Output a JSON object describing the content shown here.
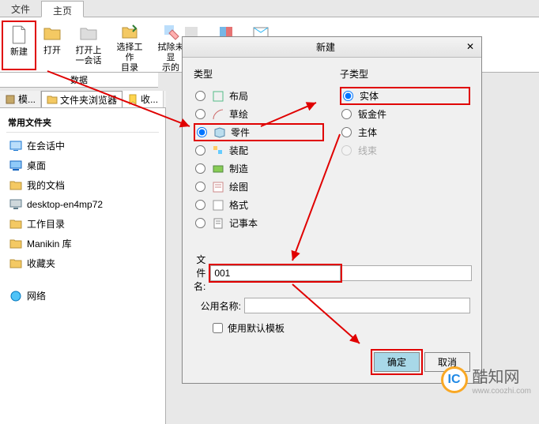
{
  "menu": {
    "file": "文件",
    "home": "主页"
  },
  "ribbon": {
    "new": "新建",
    "open": "打开",
    "open_prev": "打开上一会话",
    "select_workdir": "选择工作\n目录",
    "erase_hidden": "拭除未显\n示的",
    "group_data": "数据"
  },
  "sidebar_tabs": {
    "model": "模...",
    "browser": "文件夹浏览器",
    "collect": "收..."
  },
  "sidebar": {
    "header": "常用文件夹",
    "items": [
      {
        "label": "在会话中",
        "icon": "screen"
      },
      {
        "label": "桌面",
        "icon": "desktop"
      },
      {
        "label": "我的文档",
        "icon": "folder"
      },
      {
        "label": "desktop-en4mp72",
        "icon": "computer"
      },
      {
        "label": "工作目录",
        "icon": "folder"
      },
      {
        "label": "Manikin 库",
        "icon": "folder"
      },
      {
        "label": "收藏夹",
        "icon": "folder"
      }
    ],
    "network": "网络"
  },
  "dialog": {
    "title": "新建",
    "group_type": "类型",
    "group_subtype": "子类型",
    "types": [
      {
        "label": "布局",
        "checked": false
      },
      {
        "label": "草绘",
        "checked": false
      },
      {
        "label": "零件",
        "checked": true,
        "highlight": true
      },
      {
        "label": "装配",
        "checked": false
      },
      {
        "label": "制造",
        "checked": false
      },
      {
        "label": "绘图",
        "checked": false
      },
      {
        "label": "格式",
        "checked": false
      },
      {
        "label": "记事本",
        "checked": false
      }
    ],
    "subtypes": [
      {
        "label": "实体",
        "checked": true,
        "highlight": true
      },
      {
        "label": "钣金件",
        "checked": false
      },
      {
        "label": "主体",
        "checked": false
      },
      {
        "label": "线束",
        "checked": false,
        "disabled": true
      }
    ],
    "filename_label": "文件名:",
    "filename_value": "001",
    "pubname_label": "公用名称:",
    "pubname_value": "",
    "use_default_template": "使用默认模板",
    "ok": "确定",
    "cancel": "取消"
  },
  "watermark": {
    "name": "酷知网",
    "url": "www.coozhi.com",
    "logo": "IC"
  }
}
